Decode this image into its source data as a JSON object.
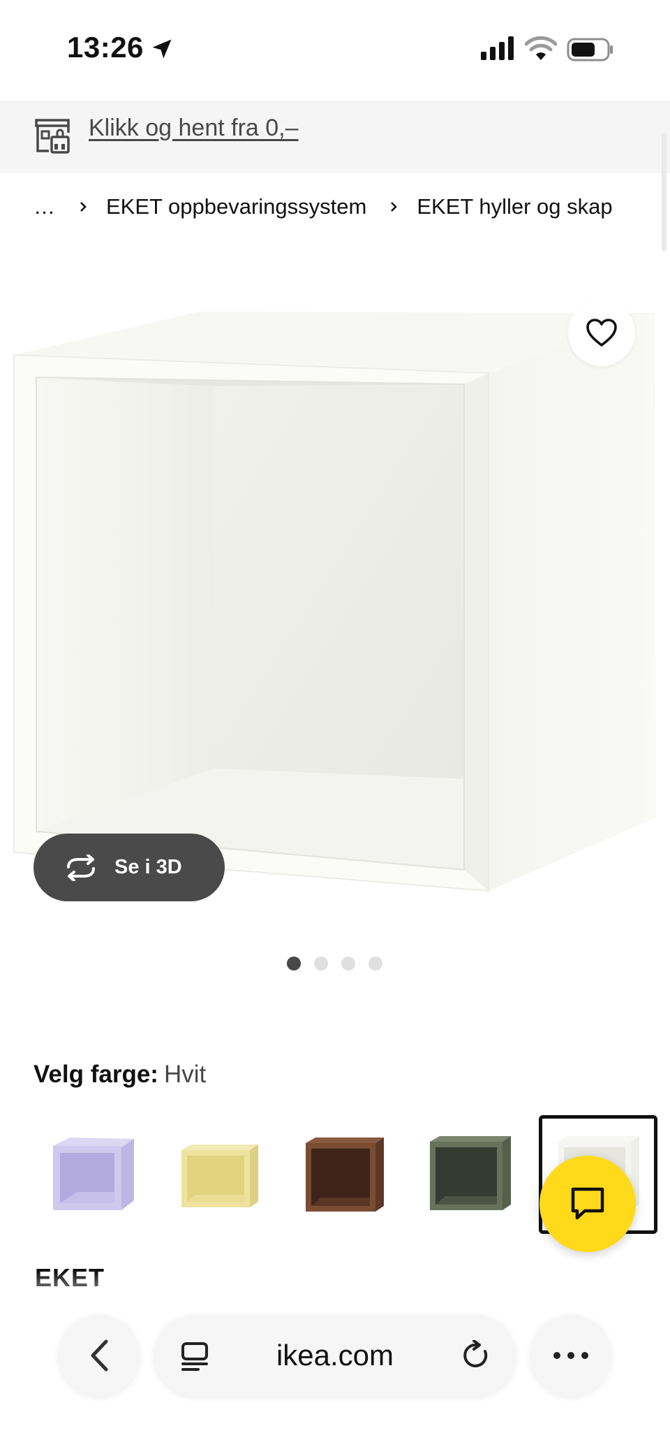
{
  "status_bar": {
    "time": "13:26",
    "location_icon": "location-arrow-icon",
    "signal_icon": "cellular-signal-icon",
    "wifi_icon": "wifi-icon",
    "battery_icon": "battery-icon"
  },
  "promo": {
    "icon": "store-pickup-icon",
    "text": "Klikk og hent fra 0,–"
  },
  "breadcrumb": {
    "items": [
      "…",
      "EKET oppbevaringssystem",
      "EKET hyller og skap"
    ]
  },
  "gallery": {
    "see_3d_label": "Se i 3D",
    "dot_count": 4,
    "active_index": 0
  },
  "color_picker": {
    "label": "Velg farge:",
    "selected_value": "Hvit",
    "swatches": [
      {
        "name": "lilac",
        "color": "#c9c4ea"
      },
      {
        "name": "light-yellow",
        "color": "#eee29e"
      },
      {
        "name": "walnut",
        "color": "#6f4530"
      },
      {
        "name": "grey-green",
        "color": "#5f6b55"
      },
      {
        "name": "white",
        "color": "#f3f2ee",
        "selected": true
      }
    ]
  },
  "product": {
    "name": "EKET"
  },
  "browser": {
    "url": "ikea.com"
  },
  "colors": {
    "chat_fab": "#ffda1a",
    "see_3d_bg": "#4a4a4a",
    "promo_bg": "#f5f5f5"
  }
}
